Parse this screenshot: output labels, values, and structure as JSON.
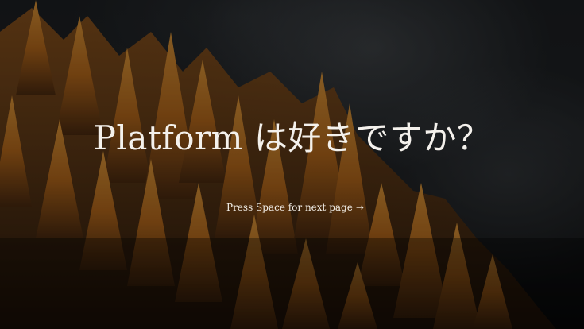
{
  "slide": {
    "title": "Platform は好きですか？",
    "next_hint_label": "Press Space for next page",
    "next_hint_icon": "arrow-right-icon",
    "next_hint_arrow": "→"
  },
  "colors": {
    "text": "#f4f1ec",
    "foliage": "#c87a22",
    "background": "#14171a"
  }
}
